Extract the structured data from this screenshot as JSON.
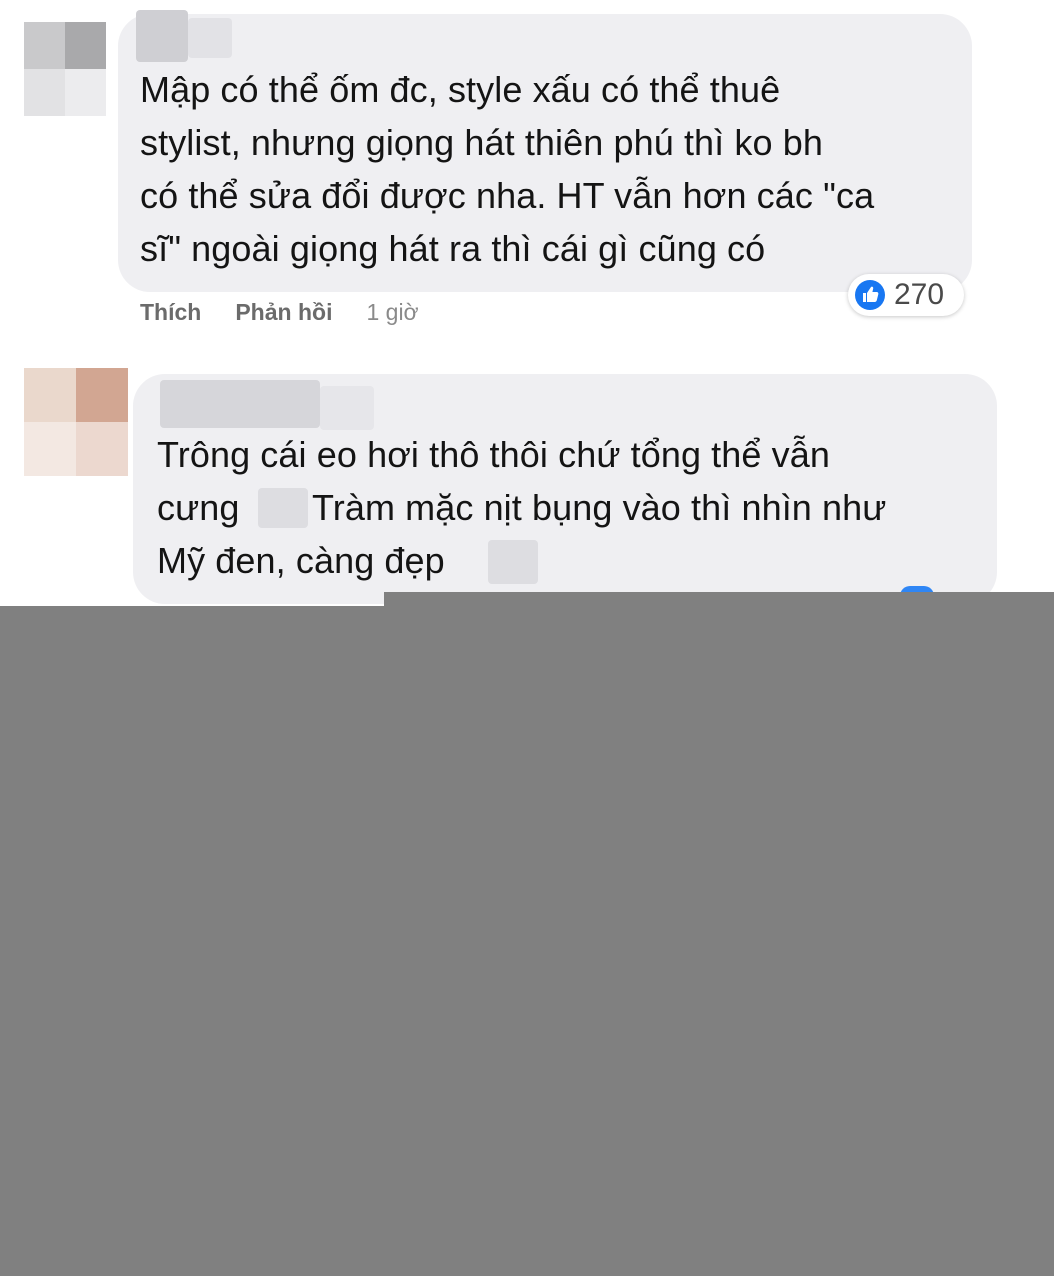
{
  "colors": {
    "bubble": "#efeff2",
    "like_blue": "#1877f2",
    "overlay_gray": "#808080",
    "avatar1_pixels": [
      "#c9c9cb",
      "#a9a9ab",
      "#e2e2e4",
      "#ececee"
    ],
    "avatar2_pixels": [
      "#ead8cc",
      "#d2a692",
      "#f3e8e2",
      "#ecd8cf"
    ]
  },
  "comments": [
    {
      "lines": [
        "Mập có thể ốm đc, style xấu có thể thuê",
        "stylist, nhưng giọng hát thiên phú thì ko bh",
        "có thể sửa đổi được nha. HT vẫn hơn các \"ca",
        "sĩ\" ngoài giọng hát ra thì cái gì cũng có"
      ],
      "actions": {
        "like": "Thích",
        "reply": "Phản hồi",
        "time": "1 giờ"
      },
      "reaction": {
        "icon": "thumbs-up-icon",
        "count": "270"
      }
    },
    {
      "lines": [
        "Trông cái eo hơi thô thôi chứ tổng thể vẫn",
        "cưng",
        "Tràm mặc nịt bụng vào thì nhìn như",
        "Mỹ đen, càng đẹp"
      ]
    }
  ]
}
